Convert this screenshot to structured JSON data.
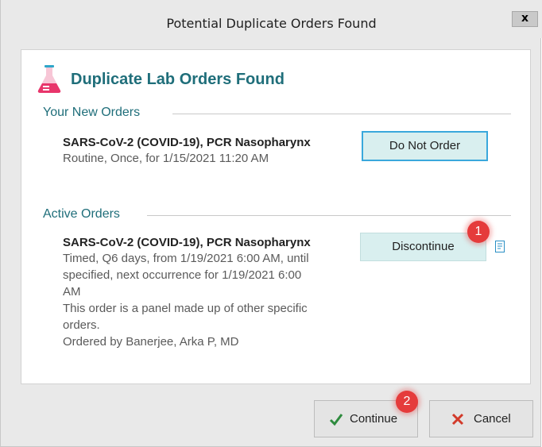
{
  "window": {
    "title": "Potential Duplicate Orders Found",
    "close_label": "x"
  },
  "heading": {
    "text": "Duplicate Lab Orders Found",
    "icon": "flask-icon"
  },
  "new_orders": {
    "section_label": "Your New Orders",
    "order": {
      "name": "SARS-CoV-2 (COVID-19), PCR Nasopharynx",
      "detail": "Routine, Once, for 1/15/2021 11:20 AM"
    },
    "button_label": "Do Not Order"
  },
  "active_orders": {
    "section_label": "Active Orders",
    "order": {
      "name": "SARS-CoV-2 (COVID-19), PCR Nasopharynx",
      "detail_lines": [
        "Timed, Q6 days, from 1/19/2021 6:00 AM, until",
        "specified, next occurrence for 1/19/2021 6:00",
        "AM",
        "This order is a panel made up of other specific",
        "orders.",
        "Ordered by Banerjee, Arka P, MD"
      ]
    },
    "button_label": "Discontinue",
    "doc_icon": "document-icon"
  },
  "badges": {
    "one": "1",
    "two": "2"
  },
  "footer": {
    "continue_label": "Continue",
    "cancel_label": "Cancel"
  },
  "colors": {
    "heading": "#1f6e7a",
    "badge": "#e53b3b",
    "button_fill": "#d9efef",
    "focus_border": "#3aa8dc",
    "check_green": "#2e8b3e",
    "cancel_red": "#d23a2a"
  }
}
